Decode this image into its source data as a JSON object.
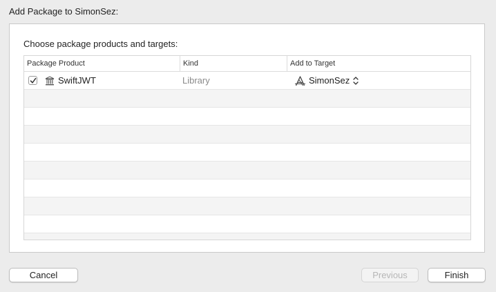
{
  "sheet": {
    "title": "Add Package to SimonSez:"
  },
  "panel": {
    "choose_label": "Choose package products and targets:"
  },
  "table": {
    "columns": [
      "Package Product",
      "Kind",
      "Add to Target"
    ],
    "rows": [
      {
        "checked": true,
        "product": "SwiftJWT",
        "product_icon": "package-library-icon",
        "kind": "Library",
        "target": "SimonSez",
        "target_icon": "app-target-icon"
      }
    ],
    "empty_row_count": 9
  },
  "buttons": {
    "cancel": "Cancel",
    "previous": "Previous",
    "finish": "Finish"
  },
  "colors": {
    "window_bg": "#ececec",
    "panel_bg": "#ffffff",
    "alt_row": "#f4f4f4",
    "disabled_text": "#b6b6b6",
    "secondary_text": "#8a8a8a"
  }
}
